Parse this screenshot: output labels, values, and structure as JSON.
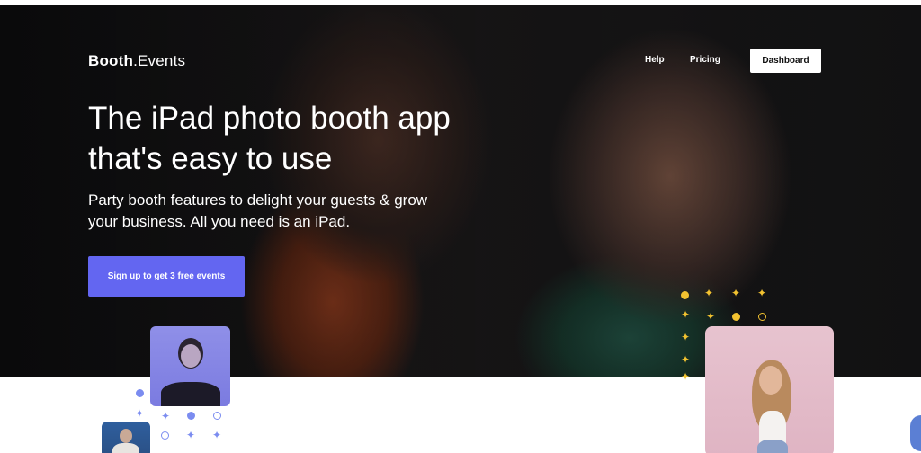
{
  "brand": {
    "name_bold": "Booth",
    "name_rest": ".Events"
  },
  "nav": {
    "help_label": "Help",
    "pricing_label": "Pricing",
    "dashboard_label": "Dashboard"
  },
  "hero": {
    "headline": "The iPad photo booth app that's easy to use",
    "subhead": "Party booth features to delight your guests & grow your business. All you need is an iPad.",
    "cta_label": "Sign up to get 3 free events"
  },
  "colors": {
    "accent": "#6366f1",
    "dark_bg": "#141416",
    "sparkle_gold": "#f2c230",
    "sparkle_blue": "#7b8cf0"
  },
  "icons": [
    "sparkle-icon",
    "dot-icon"
  ]
}
